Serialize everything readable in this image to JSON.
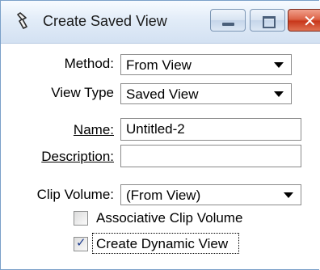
{
  "window": {
    "title": "Create Saved View",
    "icons": {
      "app": "saved-view-icon",
      "minimize": "minimize-icon",
      "maximize": "maximize-icon",
      "close": "close-icon"
    },
    "close_glyph": "✕"
  },
  "form": {
    "method": {
      "label": "Method:",
      "value": "From View"
    },
    "view_type": {
      "label": "View Type",
      "value": "Saved View"
    },
    "name": {
      "label": "Name:",
      "value": "Untitled-2"
    },
    "description": {
      "label": "Description:",
      "value": ""
    },
    "clip_volume": {
      "label": "Clip Volume:",
      "value": "(From View)"
    },
    "associative_clip_volume": {
      "label": "Associative Clip Volume",
      "checked": false
    },
    "create_dynamic_view": {
      "label": "Create Dynamic View",
      "checked": true
    }
  },
  "colors": {
    "close_button": "#c8371b",
    "title_bar": "#dbe7f5",
    "checkmark": "#1e3d8f"
  }
}
